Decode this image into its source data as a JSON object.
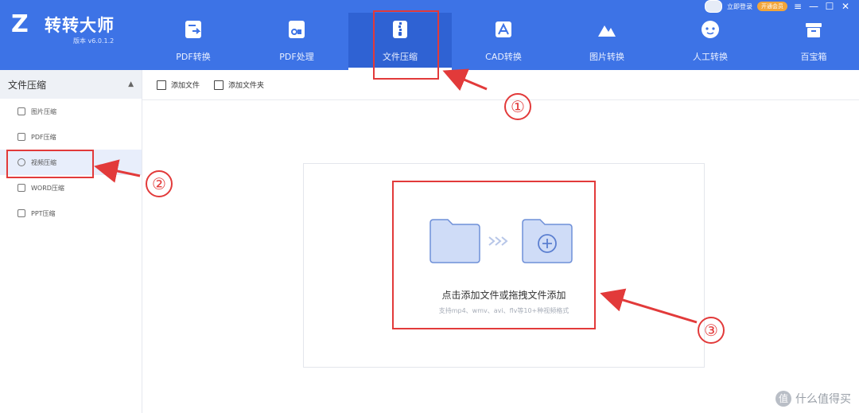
{
  "app": {
    "name": "转转大师",
    "version": "版本 v6.0.1.2",
    "login_text": "立即登录",
    "vip_badge": "开通会员"
  },
  "window_controls": [
    "≡",
    "—",
    "☐",
    "✕"
  ],
  "tabs": [
    {
      "label": "PDF转换",
      "icon": "pdf-convert-icon"
    },
    {
      "label": "PDF处理",
      "icon": "pdf-process-icon"
    },
    {
      "label": "文件压缩",
      "icon": "file-compress-icon",
      "active": true
    },
    {
      "label": "CAD转换",
      "icon": "cad-icon"
    },
    {
      "label": "图片转换",
      "icon": "image-convert-icon"
    },
    {
      "label": "人工转换",
      "icon": "manual-service-icon"
    },
    {
      "label": "百宝箱",
      "icon": "toolbox-icon"
    }
  ],
  "sidebar": {
    "header": "文件压缩",
    "items": [
      {
        "label": "图片压缩"
      },
      {
        "label": "PDF压缩"
      },
      {
        "label": "视频压缩",
        "active": true
      },
      {
        "label": "WORD压缩"
      },
      {
        "label": "PPT压缩"
      }
    ]
  },
  "toolbar": {
    "add_file": "添加文件",
    "add_folder": "添加文件夹"
  },
  "dropzone": {
    "main_text": "点击添加文件或拖拽文件添加",
    "sub_text": "支持mp4、wmv、avi、flv等10+种视频格式"
  },
  "annotations": [
    "①",
    "②",
    "③"
  ],
  "watermark": "什么值得买",
  "colors": {
    "header": "#3d73e6",
    "active_tab": "#2f62d3",
    "annotation": "#e23a3a"
  }
}
